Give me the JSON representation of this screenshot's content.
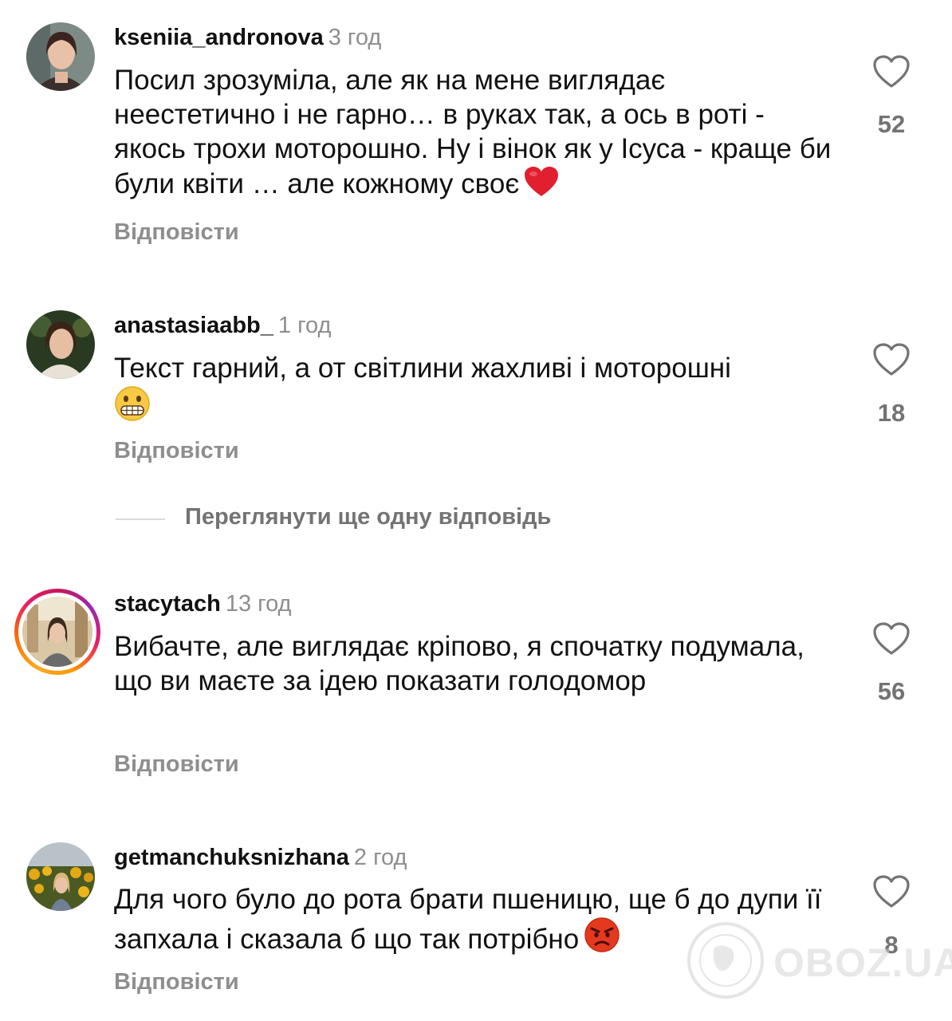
{
  "comments": [
    {
      "username": "kseniia_andronova",
      "time": "3 год",
      "text": "Посил зрозуміла, але як на мене виглядає неестетично і не гарно… в руках так, а ось в роті - якось трохи моторошно. Ну і вінок як у Ісуса - краще би були квіти … але кожному своє",
      "emoji": "red-heart",
      "reply_label": "Відповісти",
      "likes": "52"
    },
    {
      "username": "anastasiaabb_",
      "time": "1 год",
      "text": "Текст гарний, а от світлини жахливі і моторошні",
      "emoji": "grimacing-face",
      "reply_label": "Відповісти",
      "likes": "18",
      "more_replies_label": "Переглянути ще одну відповідь"
    },
    {
      "username": "stacytach",
      "time": "13 год",
      "text": "Вибачте, але виглядає кріпово, я спочатку подумала, що ви маєте за ідею показати голодомор",
      "reply_label": "Відповісти",
      "likes": "56",
      "has_story_ring": true
    },
    {
      "username": "getmanchuksnizhana",
      "time": "2 год",
      "text": "Для чого було до рота брати пшеницю, ще б до дупи її запхала і сказала б що так потрібно",
      "emoji": "angry-face",
      "reply_label": "Відповісти",
      "likes": "8"
    }
  ],
  "icons": {
    "like": "heart-outline-icon"
  },
  "watermark": {
    "text": "OBOZ.UA"
  },
  "colors": {
    "secondary_text": "#8e8e8e",
    "story_ring": "#e91e63",
    "heart_emoji": "#e0202f",
    "angry_emoji": "#e5391f"
  }
}
